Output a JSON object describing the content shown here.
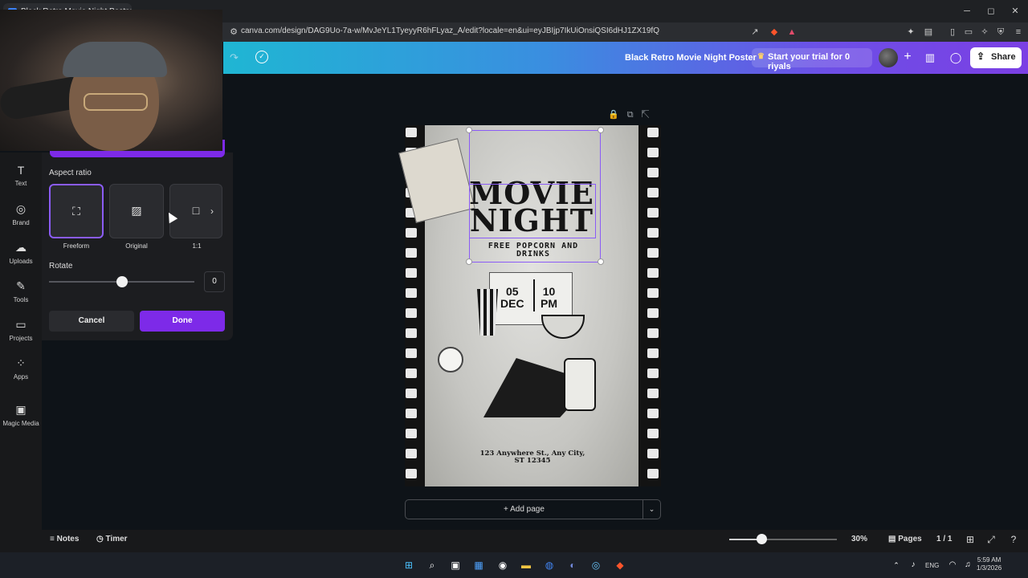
{
  "browser": {
    "tab_title": "Black Retro Movie Night Poster",
    "url": "canva.com/design/DAG9Uo-7a-w/MvJeYL1TyeyyR6hFLyaz_A/edit?locale=en&ui=eyJBIjp7IkUiOnsiQSI6dHJ1ZX19fQ",
    "win_min": "─",
    "win_max": "◻",
    "win_close": "✕"
  },
  "header": {
    "doc_title": "Black Retro Movie Night Poster",
    "trial_label": "Start your trial for 0 riyals",
    "share_label": "Share"
  },
  "rail": {
    "items": [
      {
        "label": "Text",
        "icon": "T"
      },
      {
        "label": "Brand",
        "icon": "◎"
      },
      {
        "label": "Uploads",
        "icon": "☁"
      },
      {
        "label": "Tools",
        "icon": "✎"
      },
      {
        "label": "Projects",
        "icon": "▭"
      },
      {
        "label": "Apps",
        "icon": "⁘"
      },
      {
        "label": "Magic Media",
        "icon": "▣"
      }
    ]
  },
  "crop_panel": {
    "aspect_title": "Aspect ratio",
    "ratios": [
      {
        "label": "Freeform",
        "icon": "⛶"
      },
      {
        "label": "Original",
        "icon": "▨"
      },
      {
        "label": "1:1",
        "icon": "□"
      }
    ],
    "rotate_label": "Rotate",
    "rotate_value": "0",
    "rotate_level": 0.5,
    "cancel_label": "Cancel",
    "done_label": "Done"
  },
  "poster": {
    "title_line1": "MOVIE",
    "title_line2": "NIGHT",
    "subtitle_line1": "FREE POPCORN AND",
    "subtitle_line2": "DRINKS",
    "date_day": "05",
    "date_month": "DEC",
    "time_hour": "10",
    "time_period": "PM",
    "address_line1": "123 Anywhere St., Any City,",
    "address_line2": "ST 12345"
  },
  "canvas": {
    "add_page_label": "+ Add page"
  },
  "bottom": {
    "notes_label": "Notes",
    "timer_label": "Timer",
    "zoom_value": "30%",
    "zoom_level": 0.3,
    "pages_label": "Pages",
    "page_count": "1 / 1"
  },
  "taskbar": {
    "lang": "ENG",
    "time": "5:59 AM",
    "date": "1/3/2026"
  },
  "colors": {
    "accent": "#7d2ae8",
    "selection": "#8b5cf6"
  }
}
